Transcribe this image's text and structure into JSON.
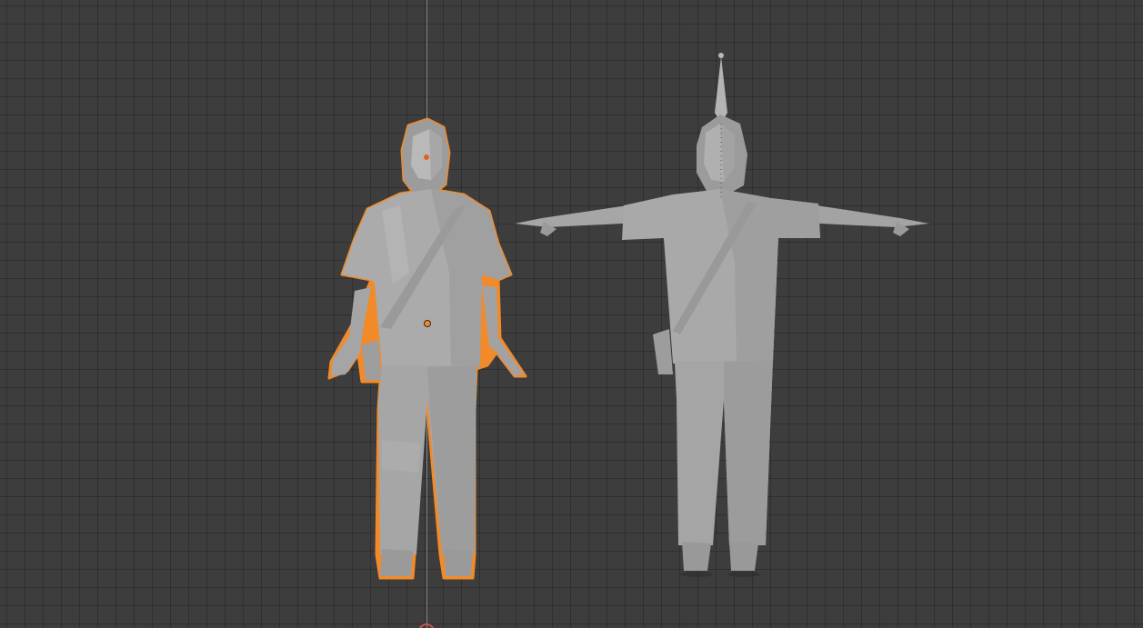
{
  "viewport": {
    "background_color": "#3d3d3d",
    "grid_color": "#2f2f2f",
    "axis_line_color": "#9a9a9a"
  },
  "objects": [
    {
      "name": "character-a-pose",
      "selected": true,
      "selection_color": "#f28a2a",
      "mesh_color": "#a9a9a9"
    },
    {
      "name": "character-t-pose",
      "selected": false,
      "mesh_color": "#a3a3a3",
      "armature_visible": true
    }
  ]
}
